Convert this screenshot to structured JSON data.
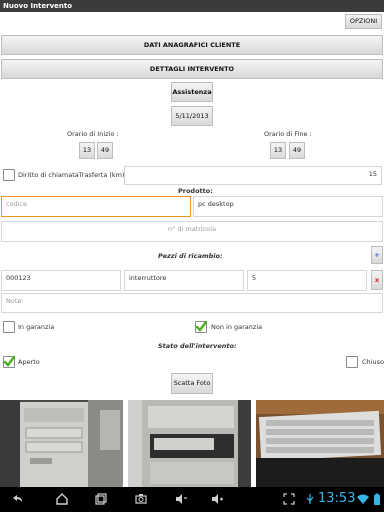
{
  "app": {
    "title": "Nuovo Intervento",
    "options_label": "OPZIONI"
  },
  "sections": {
    "customer_label": "DATI ANAGRAFICI CLIENTE",
    "details_label": "DETTAGLI INTERVENTO"
  },
  "service": {
    "type_label": "Assistenza",
    "date": "5/11/2013"
  },
  "time": {
    "start_label": "Orario di Inizio :",
    "start_hour": "13",
    "start_min": "49",
    "end_label": "Orario di Fine :",
    "end_hour": "13",
    "end_min": "49"
  },
  "call": {
    "label": "Diritto di chiamataTrasferta (km)",
    "checked": false,
    "km": "15"
  },
  "product": {
    "title": "Prodotto:",
    "code_placeholder": "codice",
    "description": "pc desktop",
    "serial_placeholder": "n° di matricola"
  },
  "parts": {
    "title": "Pezzi di ricambio:",
    "add_label": "+",
    "remove_label": "x",
    "code": "000123",
    "description": "interruttore",
    "quantity": "5",
    "notes_placeholder": "Note:"
  },
  "warranty": {
    "in_label": "In garanzia",
    "in_checked": false,
    "out_label": "Non in garanzia",
    "out_checked": true
  },
  "status": {
    "title": "Stato dell'intervento:",
    "open_label": "Aperto",
    "open_checked": true,
    "closed_label": "Chiuso",
    "closed_checked": false
  },
  "photo": {
    "button_label": "Scatta Foto"
  },
  "system": {
    "clock": "13:53",
    "accent": "#33b5e5",
    "warning_accent": "#f0961e"
  },
  "icons": [
    "back-icon",
    "home-icon",
    "recent-apps-icon",
    "screenshot-icon",
    "volume-down-icon",
    "volume-up-icon",
    "fullscreen-icon",
    "usb-debug-icon",
    "wifi-icon",
    "battery-icon"
  ]
}
